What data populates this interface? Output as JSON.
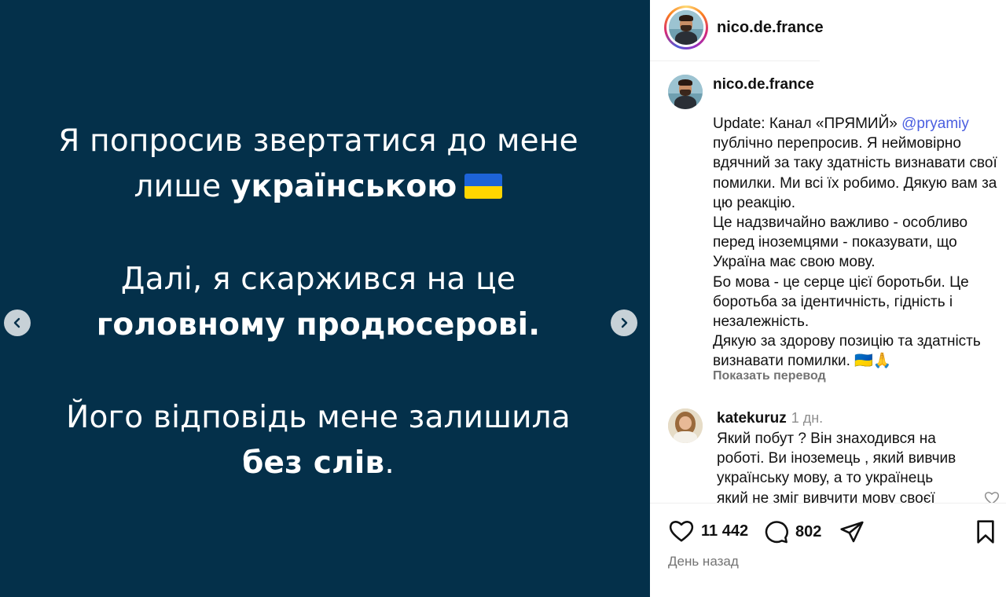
{
  "media": {
    "lines": [
      {
        "pre": "Я попросив звертатися до мене",
        "bold": "",
        "post": ""
      },
      {
        "pre": "лише ",
        "bold": "українською",
        "post": ""
      },
      {
        "pre": "Далі, я скаржився на це",
        "bold": "",
        "post": ""
      },
      {
        "pre": "",
        "bold": "головному продюсерові.",
        "post": ""
      },
      {
        "pre": "Його відповідь мене залишила",
        "bold": "",
        "post": ""
      },
      {
        "pre": "",
        "bold": "без слів",
        "post": "."
      }
    ],
    "background_color": "#04304a",
    "flag_colors": [
      "#1d63d8",
      "#ffd500"
    ]
  },
  "header": {
    "username": "nico.de.france"
  },
  "caption": {
    "username": "nico.de.france",
    "first_line_before": "Update: Канал «ПРЯМИЙ» ",
    "mention": "@pryamiy",
    "first_line_after": " публічно перепросив. Я неймовірно вдячний за таку здатність визнавати свої помилки. Ми всі їх робимо. Дякую вам за цю реакцію.",
    "p2": "Це надзвичайно важливо - особливо перед іноземцями - показувати, що Україна має свою мову.",
    "p3": "Бо мова - це серце цієї боротьби. Це боротьба за ідентичність, гідність і незалежність.",
    "p4": "Дякую за здорову позицію та здатність визнавати помилки.",
    "p4_emoji": "🇺🇦🙏",
    "translate_label": "Показать перевод"
  },
  "comment": {
    "username": "katekuruz",
    "time": "1 дн.",
    "text": "Який побут ? Він знаходився на роботі. Ви іноземець , який вивчив українську мову, а то українець який не зміг вивчити мову своєї"
  },
  "actions": {
    "likes": "11 442",
    "comments": "802",
    "date": "День назад"
  },
  "icons": {
    "prev": "chevron-left-icon",
    "next": "chevron-right-icon",
    "like": "heart-icon",
    "comment": "comment-bubble-icon",
    "share": "paper-plane-icon",
    "save": "bookmark-icon"
  }
}
